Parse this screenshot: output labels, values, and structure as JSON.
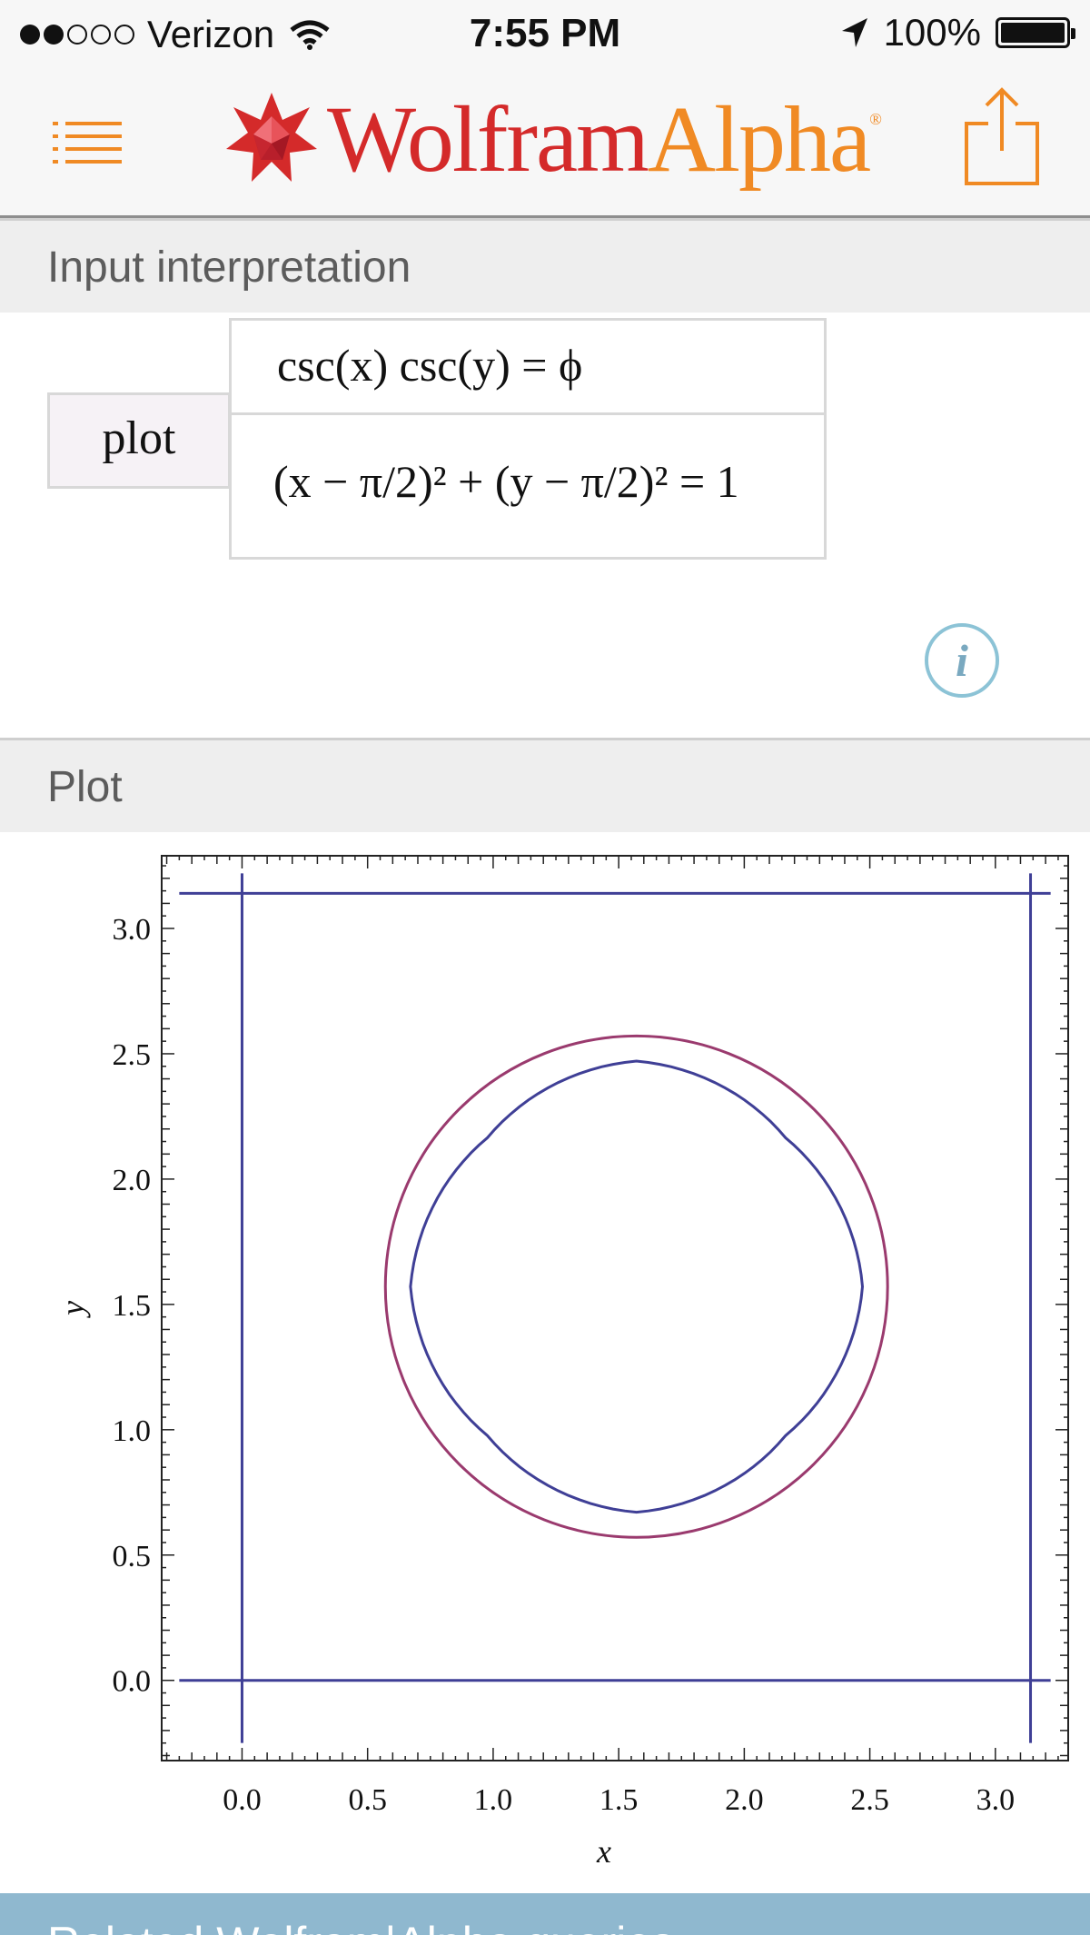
{
  "status_bar": {
    "carrier": "Verizon",
    "time": "7:55 PM",
    "battery": "100%",
    "signal_bars": 2,
    "signal_total": 5
  },
  "header": {
    "logo_part1": "Wolfram",
    "logo_part2": "Alpha",
    "logo_mark": "®",
    "menu_icon": "list-menu-icon",
    "share_icon": "share-icon",
    "accent_color": "#f08a24",
    "brand_red": "#d42a2a"
  },
  "input_interpretation": {
    "title": "Input interpretation",
    "command": "plot",
    "equation1": "csc(x) csc(y) = ϕ",
    "equation2": "(x − π/2)² + (y − π/2)² = 1",
    "info_icon": "info-icon"
  },
  "plot_section": {
    "title": "Plot"
  },
  "chart_data": {
    "type": "line",
    "xlabel": "x",
    "ylabel": "y",
    "xlim": [
      -0.32,
      3.29
    ],
    "ylim": [
      -0.32,
      3.29
    ],
    "xticks": [
      "0.0",
      "0.5",
      "1.0",
      "1.5",
      "2.0",
      "2.5",
      "3.0"
    ],
    "yticks": [
      "0.0",
      "0.5",
      "1.0",
      "1.5",
      "2.0",
      "2.5",
      "3.0"
    ],
    "grid": false,
    "series": [
      {
        "color": "#3f3f96",
        "segments": [
          [
            [
              -0.25,
              0.0
            ],
            [
              3.22,
              0.0
            ]
          ],
          [
            [
              -0.25,
              3.14
            ],
            [
              3.22,
              3.14
            ]
          ],
          [
            [
              0.0,
              -0.25
            ],
            [
              0.0,
              3.22
            ]
          ],
          [
            [
              3.14,
              -0.25
            ],
            [
              3.14,
              3.22
            ]
          ]
        ],
        "closed_curve": {
          "center": [
            1.5708,
            1.5708
          ],
          "points_polar": [
            [
              0,
              0.9
            ],
            [
              30,
              0.86
            ],
            [
              45,
              0.84
            ],
            [
              60,
              0.86
            ],
            [
              90,
              0.9
            ],
            [
              120,
              0.86
            ],
            [
              135,
              0.84
            ],
            [
              150,
              0.86
            ],
            [
              180,
              0.9
            ],
            [
              210,
              0.86
            ],
            [
              225,
              0.84
            ],
            [
              240,
              0.86
            ],
            [
              270,
              0.9
            ],
            [
              300,
              0.86
            ],
            [
              315,
              0.84
            ],
            [
              330,
              0.86
            ]
          ]
        }
      },
      {
        "color": "#9a3a6e",
        "circle": {
          "center": [
            1.5708,
            1.5708
          ],
          "radius": 1.0
        }
      }
    ]
  },
  "related": {
    "title": "Related Wolfram|Alpha queries"
  }
}
